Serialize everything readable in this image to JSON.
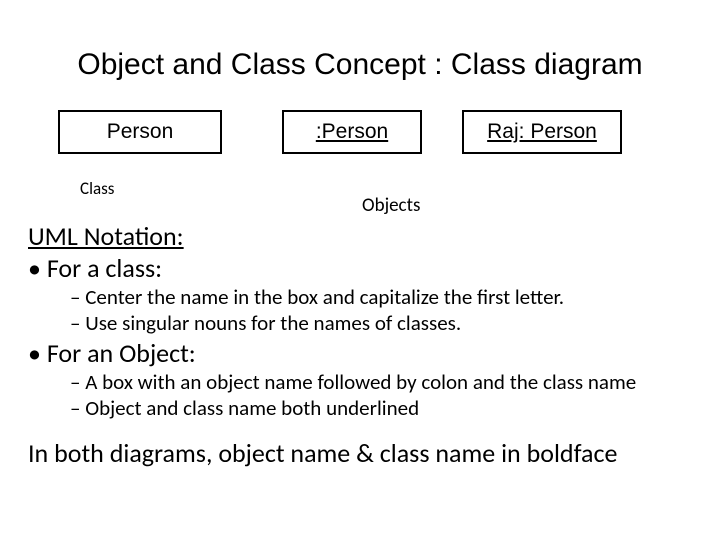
{
  "title": "Object and Class Concept : Class diagram",
  "boxes": {
    "class_box": "Person",
    "object_box_1": ":Person",
    "object_box_2": "Raj: Person"
  },
  "labels": {
    "class_label": "Class",
    "objects_label": "Objects"
  },
  "notation_heading": "UML Notation:",
  "bullets": {
    "for_class": "For a class:",
    "class_sub_1": "Center the name in the box and capitalize the first letter.",
    "class_sub_2": "Use singular nouns for the names of classes.",
    "for_object": "For an Object:",
    "object_sub_1": "A box with an object name followed by colon and the class name",
    "object_sub_2": "Object and class name both underlined"
  },
  "footer": "In both diagrams, object name & class name in boldface"
}
